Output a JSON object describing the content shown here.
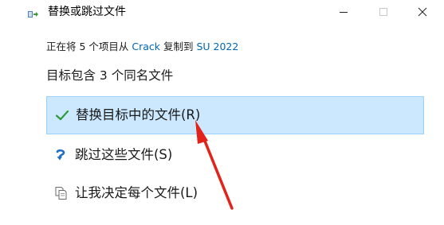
{
  "titlebar": {
    "title": "替换或跳过文件",
    "icon": "file-move-icon",
    "minimize": "—",
    "maximize": "☐",
    "close": "✕"
  },
  "header": {
    "subtitle_prefix": "正在将 5 个项目从 ",
    "source": "Crack",
    "subtitle_mid": " 复制到 ",
    "destination": "SU 2022",
    "heading": "目标包含 3 个同名文件"
  },
  "options": [
    {
      "label": "替换目标中的文件(R)",
      "icon": "checkmark-icon",
      "selected": true
    },
    {
      "label": "跳过这些文件(S)",
      "icon": "skip-arrow-icon",
      "selected": false
    },
    {
      "label": "让我决定每个文件(L)",
      "icon": "compare-files-icon",
      "selected": false
    }
  ],
  "colors": {
    "selected_background": "#cce8ff",
    "selected_border": "#99d1ff",
    "link": "#0066b4",
    "check": "#2e9a3e",
    "skip_icon": "#1e6fc4",
    "annotation_arrow": "#e2231a"
  },
  "annotation": {
    "type": "arrow",
    "points_to": "替换目标中的文件(R)"
  }
}
